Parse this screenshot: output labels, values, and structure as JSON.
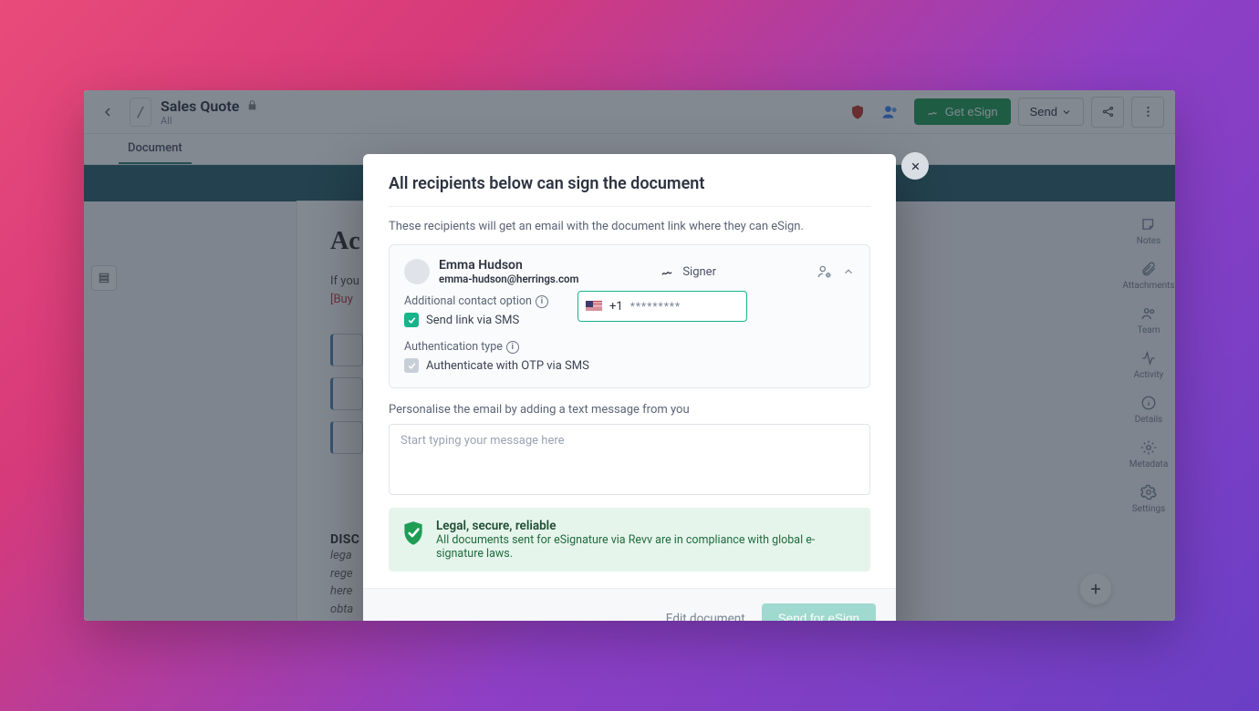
{
  "topbar": {
    "title": "Sales Quote",
    "subtitle": "All",
    "get_esign": "Get eSign",
    "send": "Send"
  },
  "tabs": {
    "document": "Document"
  },
  "sidebar": {
    "notes": "Notes",
    "attachments": "Attachments",
    "team": "Team",
    "activity": "Activity",
    "details": "Details",
    "metadata": "Metadata",
    "settings": "Settings"
  },
  "doc": {
    "heading": "Ac",
    "if_you": "If you",
    "buy": "[Buy",
    "disc": "DISC",
    "lines": [
      "lega",
      "rege",
      "here",
      "obta"
    ]
  },
  "modal": {
    "title": "All recipients below can sign the document",
    "subtitle": "These recipients will get an email with the document link where they can eSign.",
    "recipient": {
      "name": "Emma Hudson",
      "email": "emma-hudson@herrings.com",
      "role": "Signer"
    },
    "contact_label": "Additional contact option",
    "send_sms": "Send link via SMS",
    "phone_prefix": "+1",
    "phone_mask": "*********",
    "auth_label": "Authentication type",
    "auth_otp": "Authenticate with OTP via SMS",
    "personalise": "Personalise the email by adding a text message from you",
    "msg_placeholder": "Start typing your message here",
    "legal_title": "Legal, secure, reliable",
    "legal_text": "All documents sent for eSignature via Revv are in compliance with global e-signature laws.",
    "edit": "Edit document",
    "send": "Send for eSign"
  }
}
